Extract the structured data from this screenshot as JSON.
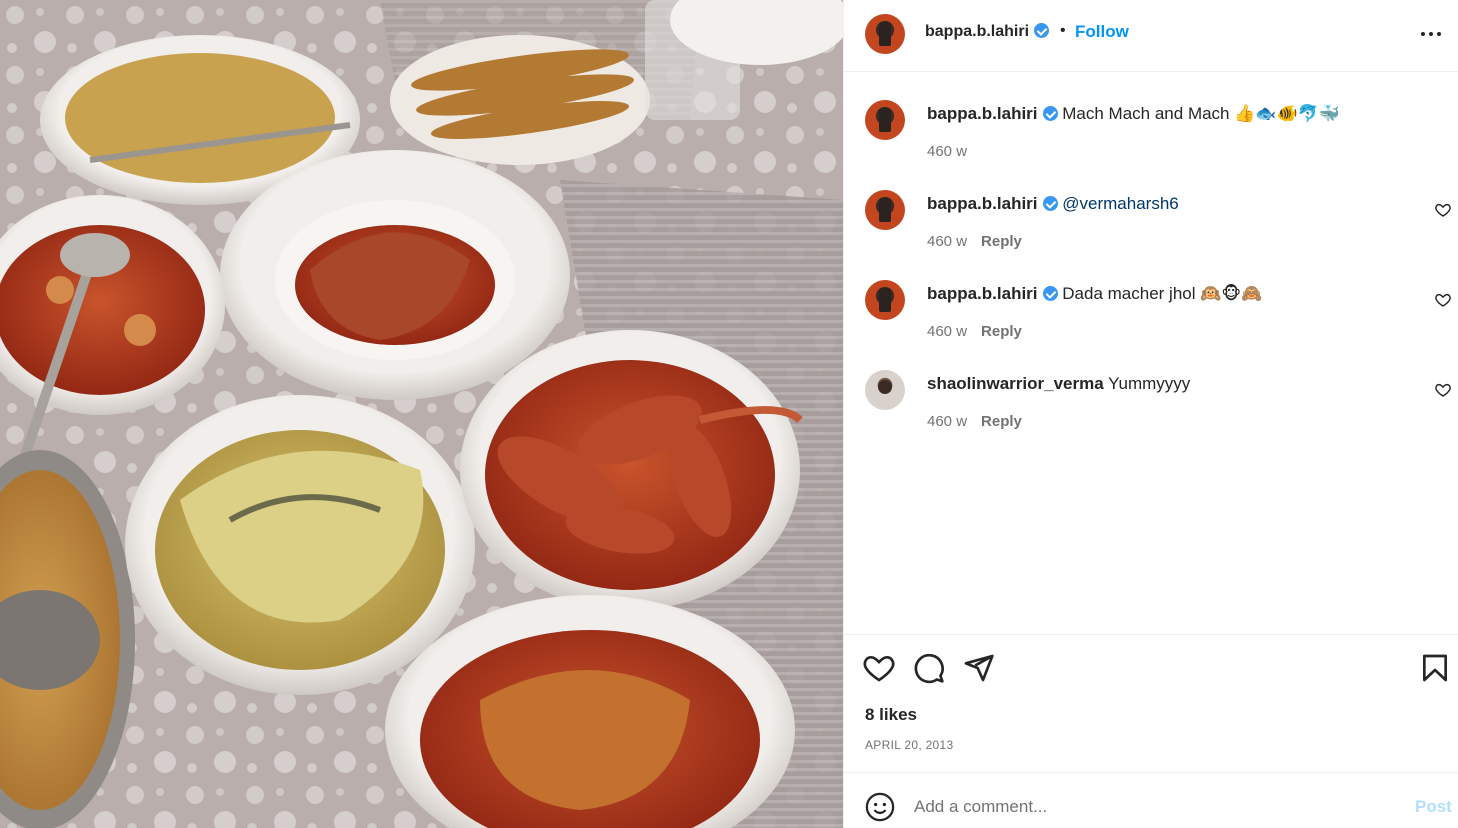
{
  "post": {
    "author": "bappa.b.lahiri",
    "follow_label": "Follow",
    "separator": "•",
    "more_icon": "more-horizontal-icon",
    "photo_alt": "Photo"
  },
  "comments": [
    {
      "user": "bappa.b.lahiri",
      "verified": true,
      "text": "Mach Mach and Mach 👍🐟🐠🐬🐳",
      "time": "460 w",
      "reply": ""
    },
    {
      "user": "bappa.b.lahiri",
      "verified": true,
      "mention": "@vermaharsh6",
      "time": "460 w",
      "reply": "Reply"
    },
    {
      "user": "bappa.b.lahiri",
      "verified": true,
      "text": "Dada macher jhol 🙉🐵🙈",
      "time": "460 w",
      "reply": "Reply"
    },
    {
      "user": "shaolinwarrior_verma",
      "verified": false,
      "text": "Yummyyyy",
      "time": "460 w",
      "reply": "Reply"
    }
  ],
  "actions": {
    "likes": "8 likes",
    "date": "APRIL 20, 2013",
    "icons": [
      "heart-icon",
      "comment-icon",
      "share-icon",
      "bookmark-icon"
    ]
  },
  "add_comment": {
    "placeholder": "Add a comment...",
    "post_label": "Post"
  },
  "colors": {
    "accent": "#0095f6",
    "verified": "#3897f0",
    "post_disabled": "#b2dffc",
    "muted": "#737373"
  }
}
